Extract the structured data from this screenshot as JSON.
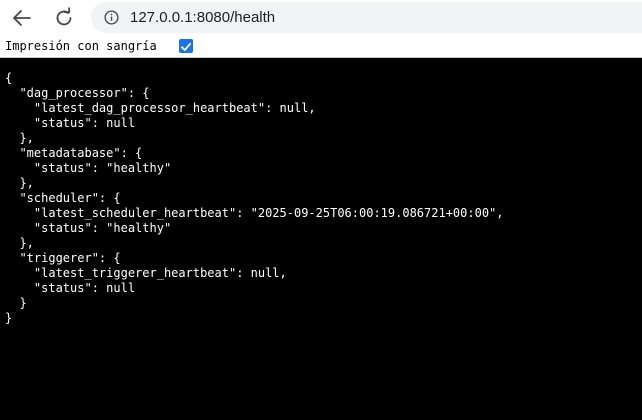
{
  "browser": {
    "url": "127.0.0.1:8080/health"
  },
  "viewer": {
    "pretty_print_label": "Impresión con sangría",
    "pretty_print_checked": true
  },
  "json_lines": [
    "{",
    "  \"dag_processor\": {",
    "    \"latest_dag_processor_heartbeat\": null,",
    "    \"status\": null",
    "  },",
    "  \"metadatabase\": {",
    "    \"status\": \"healthy\"",
    "  },",
    "  \"scheduler\": {",
    "    \"latest_scheduler_heartbeat\": \"2025-09-25T06:00:19.086721+00:00\",",
    "    \"status\": \"healthy\"",
    "  },",
    "  \"triggerer\": {",
    "    \"latest_triggerer_heartbeat\": null,",
    "    \"status\": null",
    "  }",
    "}"
  ]
}
